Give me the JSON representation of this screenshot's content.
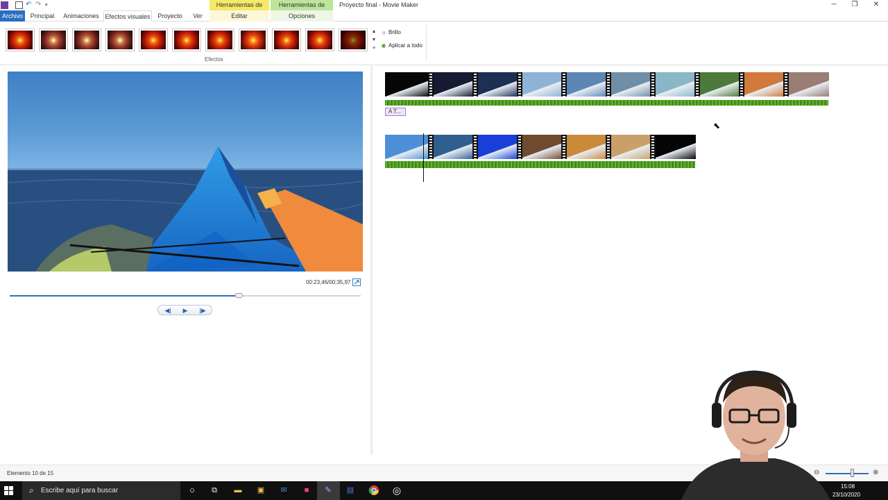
{
  "app": {
    "window_title": "Proyecto final - Movie Maker",
    "context_tabs": [
      "Herramientas de vídeo",
      "Herramientas de música"
    ]
  },
  "ribbon": {
    "tabs": [
      "Archivo",
      "Principal",
      "Animaciones",
      "Efectos visuales",
      "Proyecto",
      "Ver",
      "Editar",
      "Opciones"
    ],
    "active_tab": "Efectos visuales",
    "effects_group_label": "Efectos",
    "effects_count": 11,
    "commands": [
      {
        "label": "Brillo",
        "icon": "brightness-icon"
      },
      {
        "label": "Aplicar a todo",
        "icon": "apply-all-icon"
      }
    ]
  },
  "preview": {
    "time_display": "00:23,46/00:35,97",
    "progress": 0.652
  },
  "storyboard": {
    "caption_chip": "A T..."
  },
  "status": {
    "text": "Elemento 10 de 15",
    "zoom_level": 0.6
  },
  "taskbar": {
    "search_placeholder": "Escribe aquí para buscar",
    "time": "15:08",
    "date": "23/10/2020"
  },
  "colors": {
    "accent": "#2b6dc2",
    "video_tools": "#f4ea66",
    "music_tools": "#bde59a",
    "audio_wave": "#5aa82a"
  }
}
